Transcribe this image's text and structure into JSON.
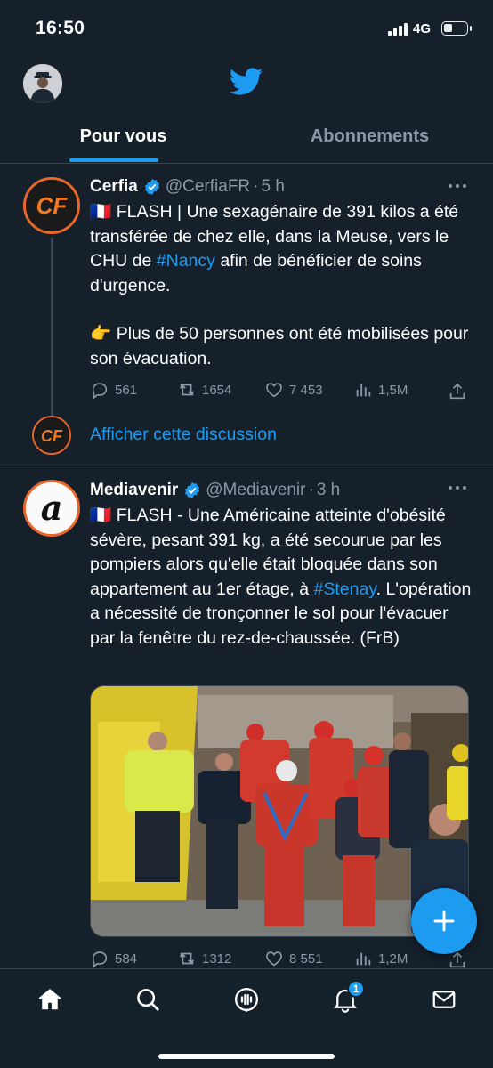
{
  "status_bar": {
    "time": "16:50",
    "network": "4G"
  },
  "header": {
    "logo_icon": "twitter-bird-icon",
    "accent_color": "#1d9bf0"
  },
  "tabs": [
    {
      "label": "Pour vous",
      "active": true
    },
    {
      "label": "Abonnements",
      "active": false
    }
  ],
  "tweets": [
    {
      "name": "Cerfia",
      "handle": "@CerfiaFR",
      "separator": "·",
      "time": "5 h",
      "text_parts": [
        {
          "text": "🇫🇷 FLASH | Une sexagénaire de 391 kilos a été transférée de chez elle, dans la Meuse, vers le CHU de "
        },
        {
          "text": "#Nancy",
          "hashtag": true
        },
        {
          "text": " afin de bénéficier de soins d'urgence."
        }
      ],
      "text_second_paragraph": "👉 Plus de 50 personnes ont été mobilisées pour son évacuation.",
      "replies": "561",
      "retweets": "1654",
      "likes": "7 453",
      "views": "1,5M",
      "show_thread": "Afficher cette discussion"
    },
    {
      "name": "Mediavenir",
      "handle": "@Mediavenir",
      "separator": "·",
      "time": "3 h",
      "text_parts": [
        {
          "text": "🇫🇷 FLASH - Une Américaine atteinte d'obésité sévère, pesant 391 kg, a été secourue par les pompiers alors qu'elle était bloquée dans son appartement au 1er étage, à "
        },
        {
          "text": "#Stenay",
          "hashtag": true
        },
        {
          "text": ". L'opération a nécessité de tronçonner le sol pour l'évacuer par la fenêtre du rez-de-chaussée. (FrB)"
        }
      ],
      "replies": "584",
      "retweets": "1312",
      "likes": "8 551",
      "views": "1,2M"
    }
  ],
  "bottom_nav": {
    "items": [
      "home-icon",
      "search-icon",
      "spaces-icon",
      "notifications-icon",
      "messages-icon"
    ],
    "notification_count": "1"
  }
}
